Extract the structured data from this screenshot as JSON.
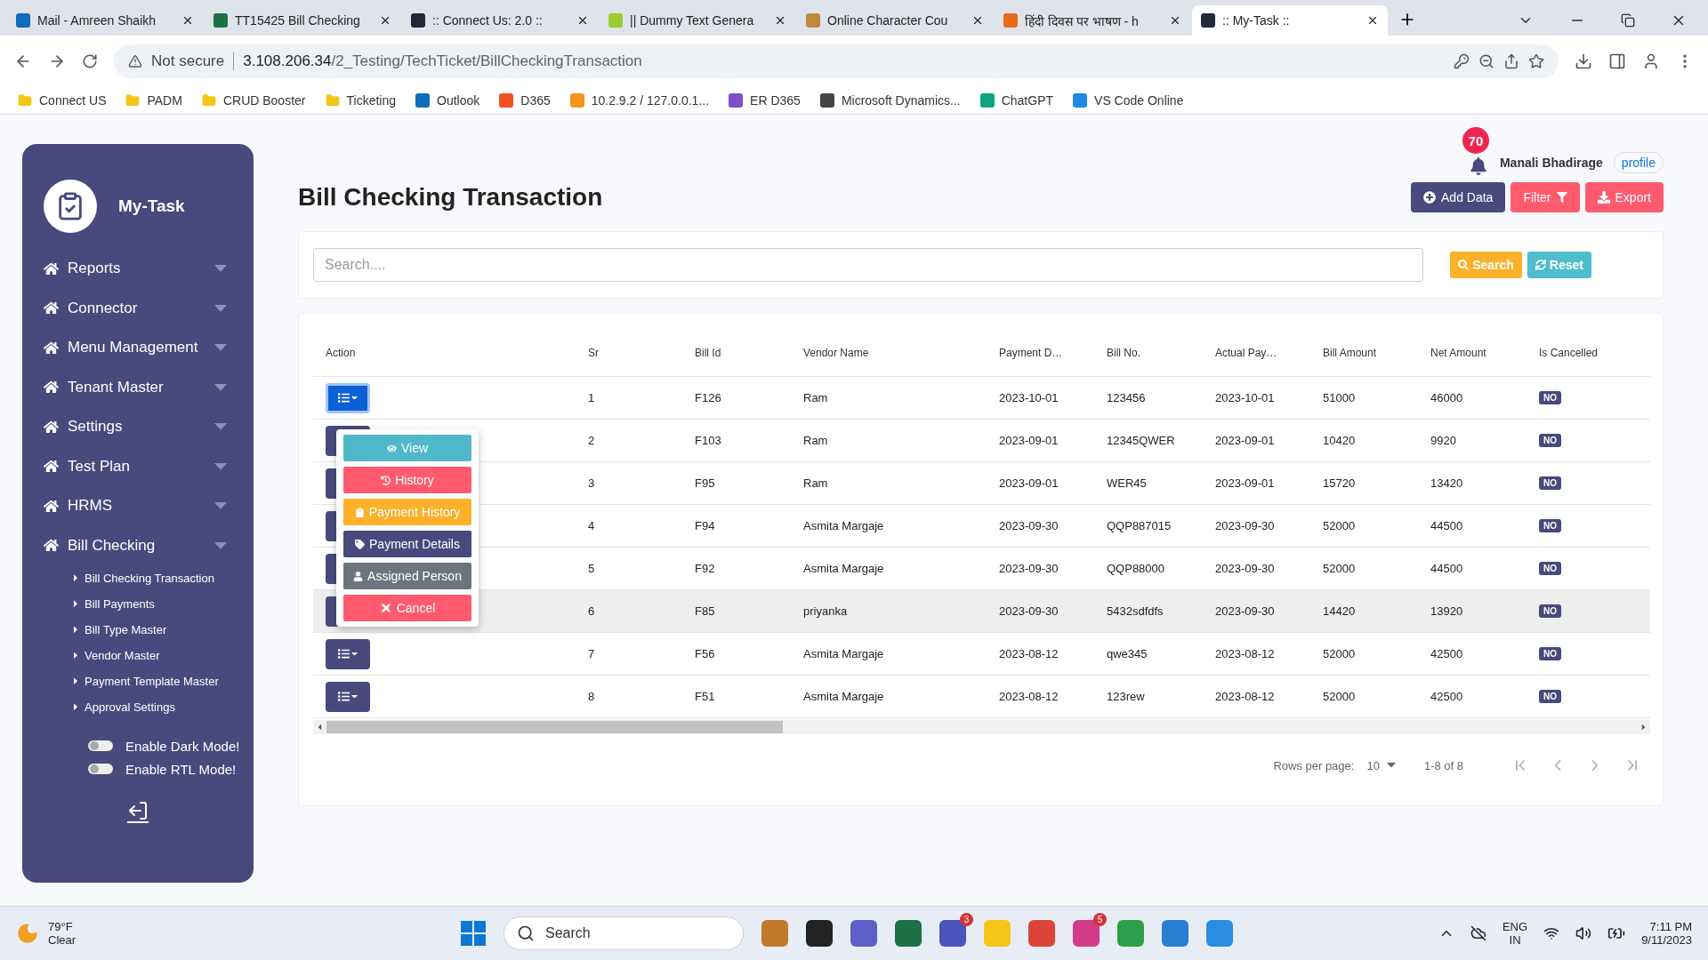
{
  "browser": {
    "tabs": [
      {
        "title": "Mail - Amreen Shaikh",
        "kind": "mail",
        "selected": false
      },
      {
        "title": "TT15425 Bill Checking",
        "kind": "sheet",
        "selected": false
      },
      {
        "title": ":: Connect Us: 2.0 ::",
        "kind": "react",
        "selected": false
      },
      {
        "title": "|| Dummy Text Genera",
        "kind": "leaf",
        "selected": false
      },
      {
        "title": "Online Character Cou",
        "kind": "box",
        "selected": false
      },
      {
        "title": "हिंदी दिवस पर भाषण - h",
        "kind": "news",
        "selected": false
      },
      {
        "title": ":: My-Task ::",
        "kind": "react",
        "selected": true
      }
    ],
    "address": {
      "security": "Not secure",
      "host": "3.108.206.34",
      "path": "/2_Testing/TechTicket/BillCheckingTransaction"
    },
    "bookmarks": [
      {
        "label": "Connect US",
        "kind": "folder"
      },
      {
        "label": "PADM",
        "kind": "folder"
      },
      {
        "label": "CRUD Booster",
        "kind": "folder"
      },
      {
        "label": "Ticketing",
        "kind": "folder"
      },
      {
        "label": "Outlook",
        "kind": "mail"
      },
      {
        "label": "D365",
        "kind": "grid"
      },
      {
        "label": "10.2.9.2 / 127.0.0.1...",
        "kind": "pma"
      },
      {
        "label": "ER D365",
        "kind": "gem"
      },
      {
        "label": "Microsoft Dynamics...",
        "kind": "globe"
      },
      {
        "label": "ChatGPT",
        "kind": "chat"
      },
      {
        "label": "VS Code Online",
        "kind": "code"
      }
    ]
  },
  "sidebar": {
    "brand": "My-Task",
    "items": [
      {
        "label": "Reports"
      },
      {
        "label": "Connector"
      },
      {
        "label": "Menu Management"
      },
      {
        "label": "Tenant Master"
      },
      {
        "label": "Settings"
      },
      {
        "label": "Test Plan"
      },
      {
        "label": "HRMS"
      },
      {
        "label": "Bill Checking",
        "children": [
          "Bill Checking Transaction",
          "Bill Payments",
          "Bill Type Master",
          "Vendor Master",
          "Payment Template Master",
          "Approval Settings"
        ]
      }
    ],
    "toggles": [
      {
        "label": "Enable Dark Mode!",
        "on": false
      },
      {
        "label": "Enable RTL Mode!",
        "on": false
      }
    ]
  },
  "header": {
    "notification_count": "70",
    "user_name": "Manali Bhadirage",
    "profile_alt": "profile"
  },
  "title": "Bill Checking Transaction",
  "actions": [
    {
      "label": "Add Data",
      "kind": "add"
    },
    {
      "label": "Filter",
      "kind": "filter"
    },
    {
      "label": "Export",
      "kind": "export"
    }
  ],
  "search": {
    "placeholder": "Search....",
    "buttons": [
      {
        "label": "Search",
        "kind": "search"
      },
      {
        "label": "Reset",
        "kind": "reset"
      }
    ]
  },
  "table": {
    "columns": [
      "Action",
      "Sr",
      "Bill Id",
      "Vendor Name",
      "Payment D…",
      "Bill No.",
      "Actual Pay…",
      "Bill Amount",
      "Net Amount",
      "Is Cancelled"
    ],
    "rows": [
      {
        "cells": [
          "",
          "1",
          "F126",
          "Ram",
          "2023-10-01",
          "123456",
          "2023-10-01",
          "51000",
          "46000"
        ],
        "cancelled": "NO",
        "menu_open": true,
        "highlighted": false
      },
      {
        "cells": [
          "",
          "2",
          "F103",
          "Ram",
          "2023-09-01",
          "12345QWER",
          "2023-09-01",
          "10420",
          "9920"
        ],
        "cancelled": "NO",
        "menu_open": false,
        "highlighted": false
      },
      {
        "cells": [
          "",
          "3",
          "F95",
          "Ram",
          "2023-09-01",
          "WER45",
          "2023-09-01",
          "15720",
          "13420"
        ],
        "cancelled": "NO",
        "menu_open": false,
        "highlighted": false
      },
      {
        "cells": [
          "",
          "4",
          "F94",
          "Asmita Margaje",
          "2023-09-30",
          "QQP887015",
          "2023-09-30",
          "52000",
          "44500"
        ],
        "cancelled": "NO",
        "menu_open": false,
        "highlighted": false
      },
      {
        "cells": [
          "",
          "5",
          "F92",
          "Asmita Margaje",
          "2023-09-30",
          "QQP88000",
          "2023-09-30",
          "52000",
          "44500"
        ],
        "cancelled": "NO",
        "menu_open": false,
        "highlighted": false
      },
      {
        "cells": [
          "",
          "6",
          "F85",
          "priyanka",
          "2023-09-30",
          "5432sdfdfs",
          "2023-09-30",
          "14420",
          "13920"
        ],
        "cancelled": "NO",
        "menu_open": false,
        "highlighted": true
      },
      {
        "cells": [
          "",
          "7",
          "F56",
          "Asmita Margaje",
          "2023-08-12",
          "qwe345",
          "2023-08-12",
          "52000",
          "42500"
        ],
        "cancelled": "NO",
        "menu_open": false,
        "highlighted": false
      },
      {
        "cells": [
          "",
          "8",
          "F51",
          "Asmita Margaje",
          "2023-08-12",
          "123rew",
          "2023-08-12",
          "52000",
          "42500"
        ],
        "cancelled": "NO",
        "menu_open": false,
        "highlighted": false
      }
    ],
    "menu": [
      {
        "label": "View",
        "kind": "view"
      },
      {
        "label": "History",
        "kind": "history"
      },
      {
        "label": "Payment History",
        "kind": "payment_history"
      },
      {
        "label": "Payment Details",
        "kind": "payment_details"
      },
      {
        "label": "Assigned Person",
        "kind": "assigned"
      },
      {
        "label": "Cancel",
        "kind": "cancel"
      }
    ]
  },
  "pagination": {
    "rows_label": "Rows per page:",
    "rows_value": "10",
    "range": "1-8 of 8"
  },
  "taskbar": {
    "temperature": "79°F",
    "condition": "Clear",
    "search_placeholder": "Search",
    "apps": [
      {
        "kind": "work"
      },
      {
        "kind": "files"
      },
      {
        "kind": "meet"
      },
      {
        "kind": "excel"
      },
      {
        "kind": "teams",
        "badge": "3"
      },
      {
        "kind": "folder"
      },
      {
        "kind": "chrome"
      },
      {
        "kind": "wps",
        "badge": "5"
      },
      {
        "kind": "install"
      },
      {
        "kind": "photos"
      },
      {
        "kind": "dolphin"
      }
    ],
    "language": "ENG",
    "region": "IN",
    "time": "7:11 PM",
    "date": "9/11/2023"
  }
}
